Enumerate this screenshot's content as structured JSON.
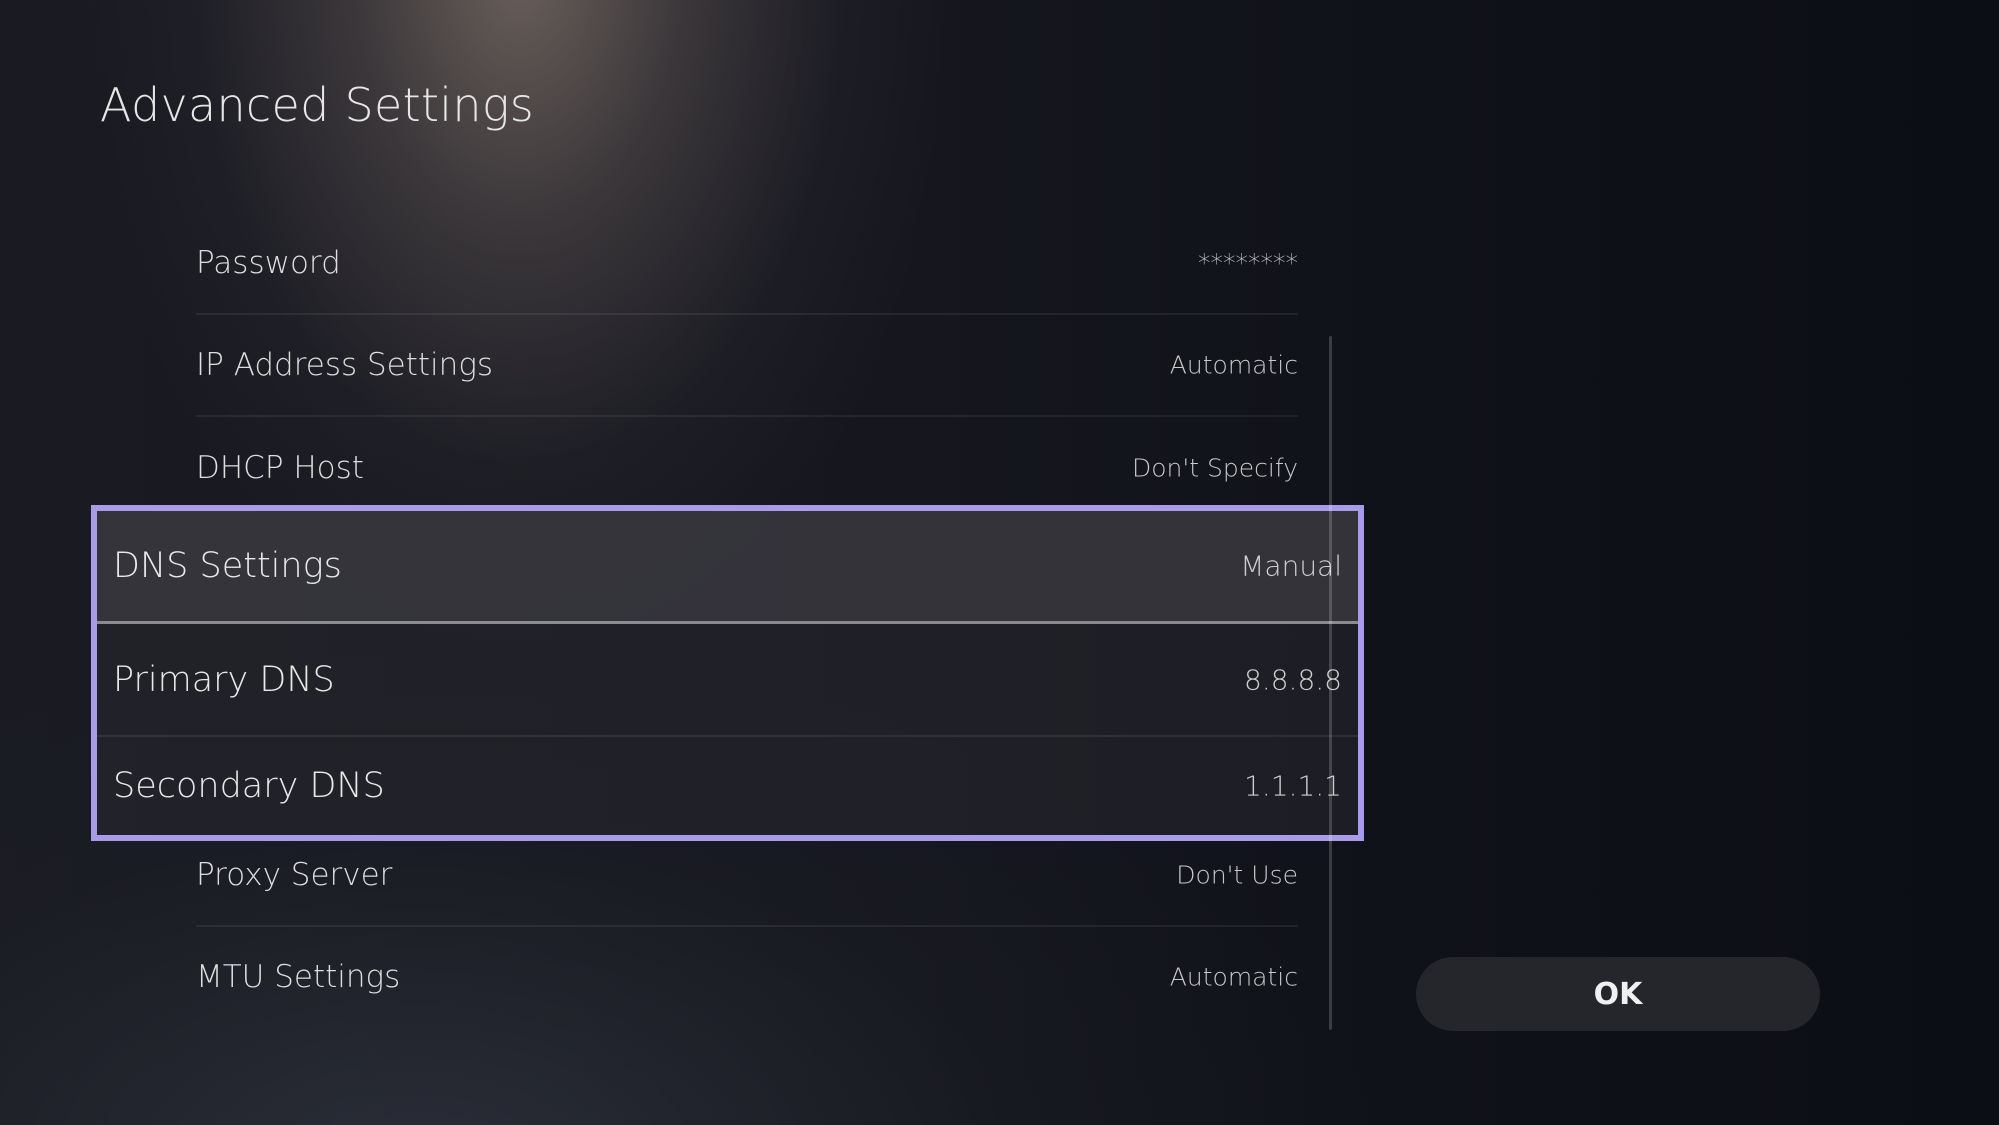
{
  "header": {
    "title": "Advanced Settings"
  },
  "settings": [
    {
      "label": "Password",
      "value": "********"
    },
    {
      "label": "IP Address Settings",
      "value": "Automatic"
    },
    {
      "label": "DHCP Host",
      "value": "Don't Specify"
    },
    {
      "label": "DNS Settings",
      "value": "Manual"
    },
    {
      "label": "Primary DNS",
      "value": "8.8.8.8"
    },
    {
      "label": "Secondary DNS",
      "value": "1.1.1.1"
    },
    {
      "label": "Proxy Server",
      "value": "Don't Use"
    },
    {
      "label": "MTU Settings",
      "value": "Automatic"
    }
  ],
  "actions": {
    "ok_label": "OK"
  },
  "colors": {
    "focus_border": "#a99be8",
    "background": "#0f1118"
  }
}
